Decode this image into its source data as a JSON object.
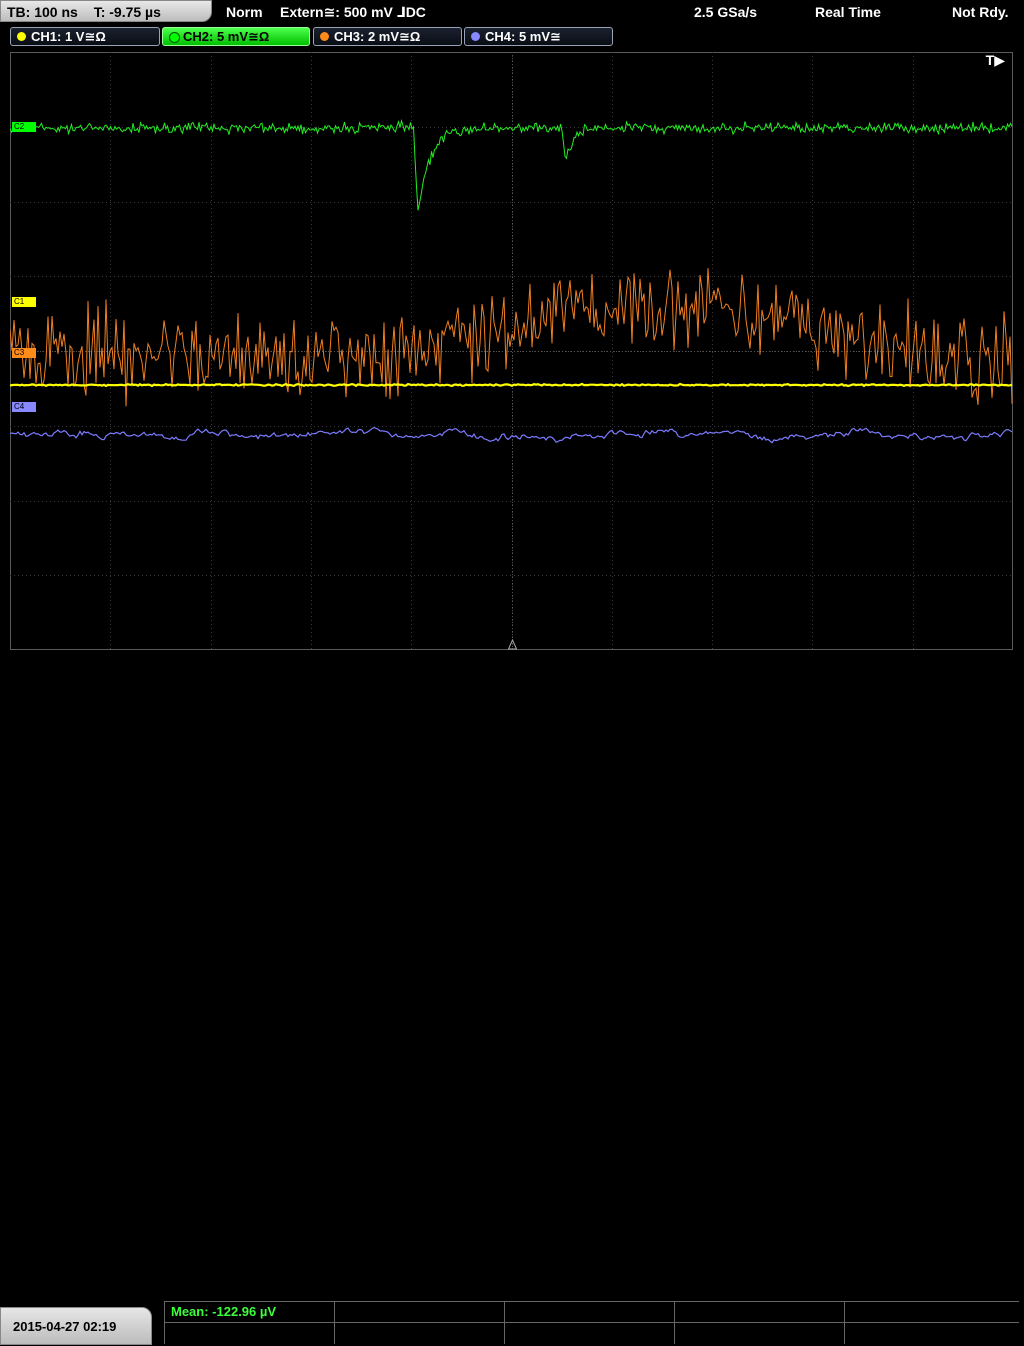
{
  "topbar": {
    "timebase": "TB: 100 ns",
    "trigger_time": "T: -9.75 µs",
    "mode": "Norm",
    "trigger_source": "Extern≅: 500 mV ⅃DC",
    "sample_rate": "2.5 GSa/s",
    "acq_mode": "Real Time",
    "status": "Not Rdy."
  },
  "channels": [
    {
      "label": "CH1: 1 V≅Ω",
      "color": "#ffff00"
    },
    {
      "label": "CH2: 5 mV≅Ω",
      "color": "#00ff00"
    },
    {
      "label": "CH3: 2 mV≅Ω",
      "color": "#ff8c1a"
    },
    {
      "label": "CH4: 5 mV≅",
      "color": "#8888ff"
    }
  ],
  "screen": {
    "trigger_marker": "T▶",
    "labels": {
      "c2": "C2",
      "c1": "C1",
      "c3": "C3",
      "c4": "C4"
    }
  },
  "footer": {
    "datetime": "2015-04-27 02:19",
    "mean": "Mean: -122.96 µV"
  }
}
